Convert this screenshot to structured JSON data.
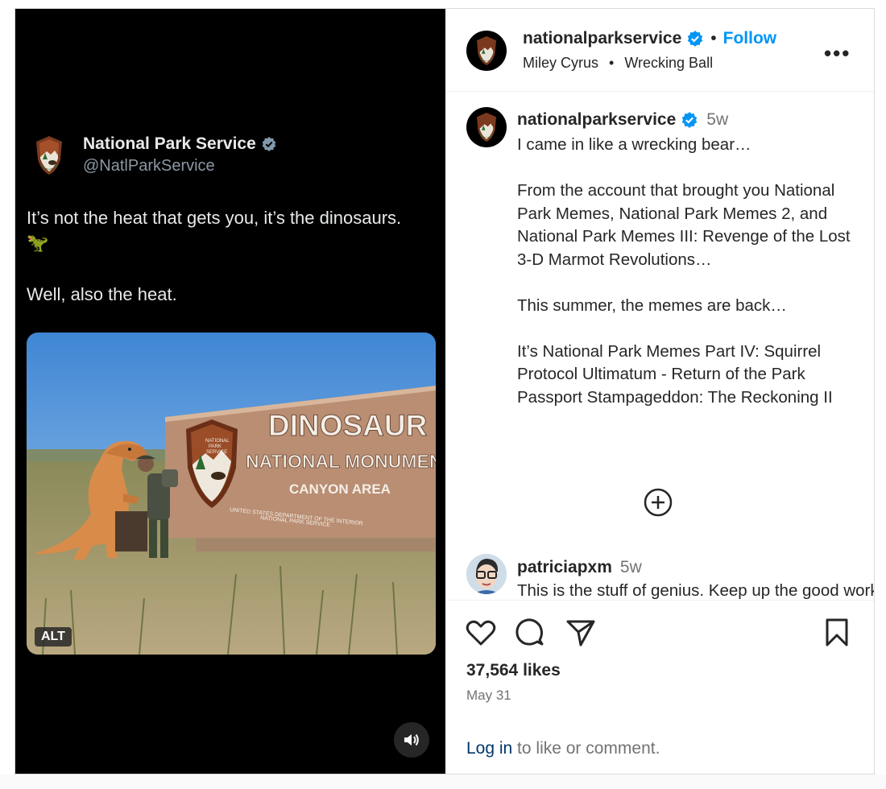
{
  "media": {
    "tweet_name": "National Park Service",
    "tweet_handle": "@NatlParkService",
    "tweet_line1": "It’s not the heat that gets you, it’s the dinosaurs.",
    "tweet_emoji": "🦖",
    "tweet_line2": "Well, also the heat.",
    "sign_line1": "DINOSAUR",
    "sign_line2": "NATIONAL MONUMENT",
    "sign_line3": "CANYON AREA",
    "sign_small1": "UNITED STATES DEPARTMENT OF THE INTERIOR",
    "sign_small2": "NATIONAL PARK SERVICE",
    "badge_line1": "NATIONAL",
    "badge_line2": "PARK",
    "badge_line3": "SERVICE",
    "alt_label": "ALT"
  },
  "header": {
    "username": "nationalparkservice",
    "separator": "•",
    "follow_label": "Follow",
    "music_artist": "Miley Cyrus",
    "music_separator": "•",
    "music_track": "Wrecking Ball",
    "more_label": "•••"
  },
  "caption": {
    "username": "nationalparkservice",
    "time": "5w",
    "paragraphs": [
      "I came in like a wrecking bear…",
      "From the account that brought you National Park Memes, National Park Memes 2, and National Park Memes III: Revenge of the Lost 3-D Marmot Revolutions…",
      "This summer, the memes are back…",
      "It’s National Park Memes Part IV: Squirrel Protocol Ultimatum - Return of the Park Passport Stampageddon: The Reckoning II"
    ]
  },
  "comment": {
    "username": "patriciapxm",
    "time": "5w",
    "text": "This is the stuff of genius. Keep up the good work!"
  },
  "stats": {
    "likes": "37,564 likes",
    "date": "May 31"
  },
  "login": {
    "link": "Log in",
    "rest": " to like or comment."
  },
  "colors": {
    "follow_blue": "#0095f6",
    "verified_blue": "#0095f6",
    "link_dark_blue": "#00376b",
    "media_bg": "#000000"
  }
}
